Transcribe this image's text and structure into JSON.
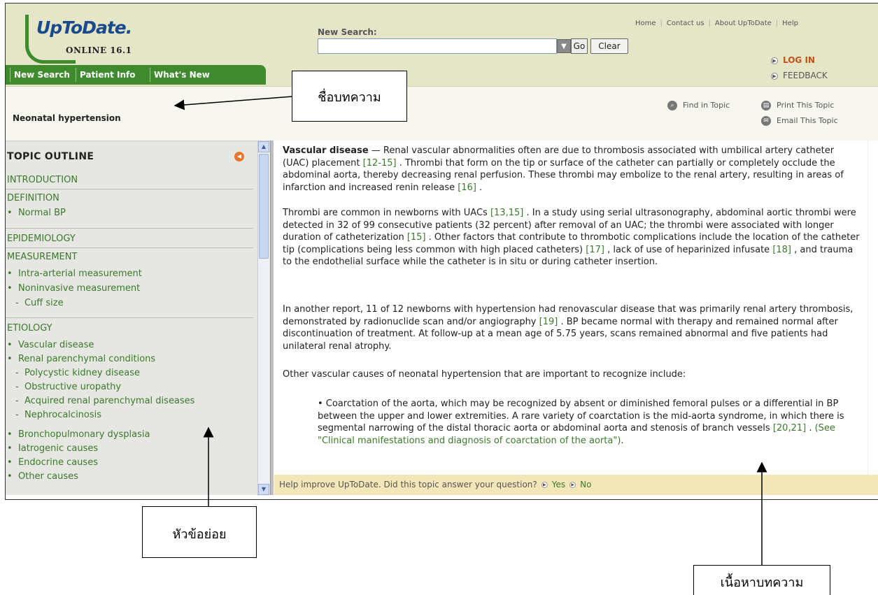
{
  "header": {
    "logo_word": "UpToDate.",
    "logo_version": "ONLINE 16.1",
    "search_label": "New Search:",
    "search_value": "",
    "go_label": "Go",
    "clear_label": "Clear",
    "top_links": [
      "Home",
      "Contact us",
      "About UpToDate",
      "Help"
    ],
    "login_label": "LOG IN",
    "feedback_label": "FEEDBACK",
    "tabs": [
      "New Search",
      "Patient Info",
      "What's New"
    ]
  },
  "titlebar": {
    "title": "Neonatal hypertension",
    "find_label": "Find in Topic",
    "print_label": "Print This Topic",
    "email_label": "Email This Topic"
  },
  "outline": {
    "heading": "TOPIC OUTLINE",
    "sections": {
      "introduction": "INTRODUCTION",
      "definition": "DEFINITION",
      "normal_bp": "Normal BP",
      "epidemiology": "EPIDEMIOLOGY",
      "measurement": "MEASUREMENT",
      "intra_arterial": "Intra-arterial measurement",
      "noninvasive": "Noninvasive measurement",
      "cuff_size": "Cuff size",
      "etiology": "ETIOLOGY",
      "vascular": "Vascular disease",
      "renal_parenchymal": "Renal parenchymal conditions",
      "polycystic": "Polycystic kidney disease",
      "obstructive": "Obstructive uropathy",
      "acquired": "Acquired renal parenchymal diseases",
      "nephrocalcinosis": "Nephrocalcinosis",
      "bronchopulmonary": "Bronchopulmonary dysplasia",
      "iatrogenic": "Iatrogenic causes",
      "endocrine": "Endocrine causes",
      "other": "Other causes"
    }
  },
  "content": {
    "p1_bold": "Vascular disease",
    "p1_a": " — Renal vascular abnormalities often are due to thrombosis associated with umbilical artery catheter (UAC) placement ",
    "p1_r1": "[12-15]",
    "p1_b": " . Thrombi that form on the tip or surface of the catheter can partially or completely occlude the abdominal aorta, thereby decreasing renal perfusion. These thrombi may embolize to the renal artery, resulting in areas of infarction and increased renin release ",
    "p1_r2": "[16]",
    "p1_c": " .",
    "p2_a": "Thrombi are common in newborns with UACs ",
    "p2_r1": "[13,15]",
    "p2_b": " . In a study using serial ultrasonography, abdominal aortic thrombi were detected in 32 of 99 consecutive patients (32 percent) after removal of an UAC; the thrombi were associated with longer duration of catheterization ",
    "p2_r2": "[15]",
    "p2_c": " . Other factors that contribute to thrombotic complications include the location of the catheter tip (complications being less common with high placed catheters) ",
    "p2_r3": "[17]",
    "p2_d": " , lack of use of heparinized infusate ",
    "p2_r4": "[18]",
    "p2_e": " , and trauma to the endothelial surface while the catheter is in situ or during catheter insertion.",
    "p3_a": "In another report, 11 of 12 newborns with hypertension had renovascular disease that was primarily renal artery thrombosis, demonstrated by radionuclide scan and/or angiography ",
    "p3_r1": "[19]",
    "p3_b": " . BP became normal with therapy and remained normal after discontinuation of treatment. At follow-up at a mean age of 5.75 years, scans remained abnormal and five patients had unilateral renal atrophy.",
    "p4": "Other vascular causes of neonatal hypertension that are important to recognize include:",
    "b1_a": "• Coarctation of the aorta, which may be recognized by absent or diminished femoral pulses or a differential in BP between the upper and lower extremities. A rare variety of coarctation is the mid-aorta syndrome, in which there is segmental narrowing of the distal thoracic aorta or abdominal aorta and stenosis of branch vessels ",
    "b1_r1": "[20,21]",
    "b1_b": " . ",
    "b1_link": "(See \"Clinical manifestations and diagnosis of coarctation of the aorta\")",
    "b1_c": "."
  },
  "feedback_bar": {
    "question": "Help improve UpToDate. Did this topic answer your question?",
    "yes": "Yes",
    "no": "No"
  },
  "annotations": {
    "title_label": "ชื่อบทความ",
    "subtopic_label": "หัวข้อย่อย",
    "content_label": "เนื้อหาบทความ"
  }
}
